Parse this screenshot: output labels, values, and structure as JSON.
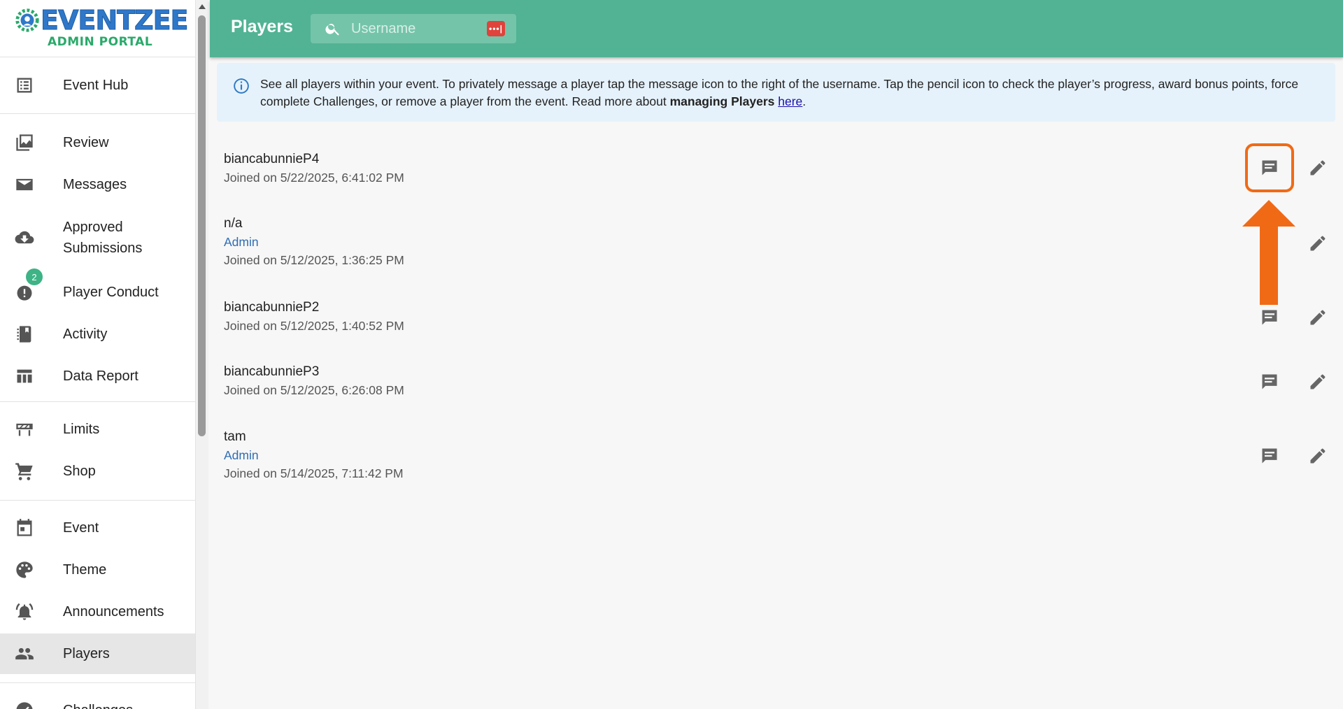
{
  "brand": {
    "name": "EVENTZEE",
    "subtitle": "ADMIN PORTAL"
  },
  "sidebar": {
    "items": [
      {
        "label": "Event Hub",
        "icon": "list-icon"
      },
      {
        "label": "Review",
        "icon": "images-icon"
      },
      {
        "label": "Messages",
        "icon": "envelope-icon"
      },
      {
        "label": "Approved\nSubmissions",
        "icon": "cloud-download-icon"
      },
      {
        "label": "Player Conduct",
        "icon": "alert-icon",
        "badge": "2"
      },
      {
        "label": "Activity",
        "icon": "notebook-icon"
      },
      {
        "label": "Data Report",
        "icon": "table-icon"
      },
      {
        "label": "Limits",
        "icon": "barrier-icon"
      },
      {
        "label": "Shop",
        "icon": "cart-icon"
      },
      {
        "label": "Event",
        "icon": "calendar-icon"
      },
      {
        "label": "Theme",
        "icon": "palette-icon"
      },
      {
        "label": "Announcements",
        "icon": "bell-icon"
      },
      {
        "label": "Players",
        "icon": "people-icon",
        "active": true
      },
      {
        "label": "Challenges",
        "icon": "check-circle-icon"
      }
    ]
  },
  "header": {
    "title": "Players",
    "search_placeholder": "Username"
  },
  "info": {
    "text_before": "See all players within your event. To privately message a player tap the message icon to the right of the username. Tap the pencil icon to check the player’s progress, award bonus points, force complete Challenges, or remove a player from the event. Read more about ",
    "bold": "managing Players",
    "space": " ",
    "link": "here",
    "period": "."
  },
  "players": [
    {
      "username": "biancabunnieP4",
      "role": "",
      "joined": "Joined on 5/22/2025, 6:41:02 PM"
    },
    {
      "username": "n/a",
      "role": "Admin",
      "joined": "Joined on 5/12/2025, 1:36:25 PM"
    },
    {
      "username": "biancabunnieP2",
      "role": "",
      "joined": "Joined on 5/12/2025, 1:40:52 PM"
    },
    {
      "username": "biancabunnieP3",
      "role": "",
      "joined": "Joined on 5/12/2025, 6:26:08 PM"
    },
    {
      "username": "tam",
      "role": "Admin",
      "joined": "Joined on 5/14/2025, 7:11:42 PM"
    }
  ],
  "colors": {
    "header": "#52b394",
    "accent": "#f06a16",
    "link": "#2e6db4",
    "badge": "#3eb386"
  }
}
